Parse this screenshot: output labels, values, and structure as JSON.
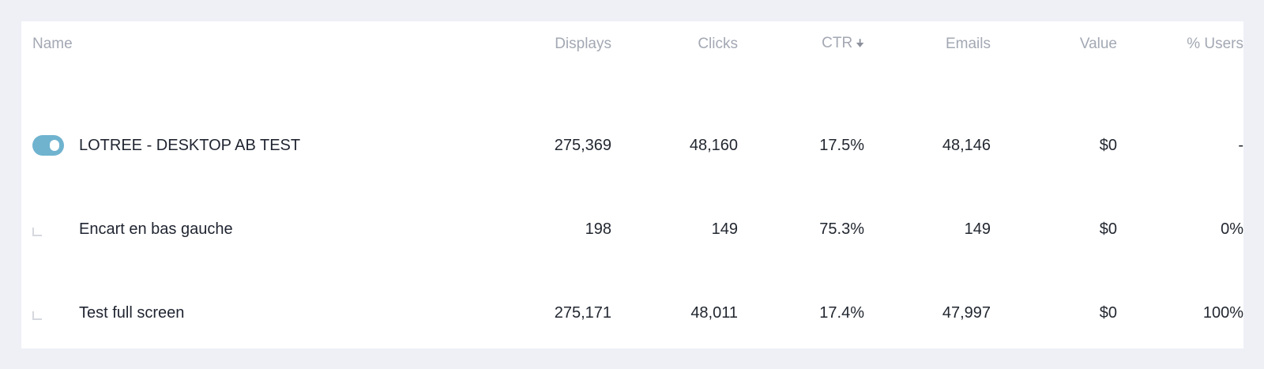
{
  "table": {
    "columns": {
      "name": "Name",
      "displays": "Displays",
      "clicks": "Clicks",
      "ctr": "CTR",
      "emails": "Emails",
      "value": "Value",
      "users": "% Users"
    },
    "sort_icon": "arrow-down-icon",
    "rows": [
      {
        "name": "LOTREE - DESKTOP AB TEST",
        "enabled": true,
        "displays": "275,369",
        "clicks": "48,160",
        "ctr": "17.5%",
        "emails": "48,146",
        "value": "$0",
        "users": "-"
      },
      {
        "name": "Encart en bas gauche",
        "displays": "198",
        "clicks": "149",
        "ctr": "75.3%",
        "emails": "149",
        "value": "$0",
        "users": "0%"
      },
      {
        "name": "Test full screen",
        "displays": "275,171",
        "clicks": "48,011",
        "ctr": "17.4%",
        "emails": "47,997",
        "value": "$0",
        "users": "100%"
      }
    ]
  },
  "colors": {
    "toggle_on": "#6fb3cf",
    "background": "#eef0f6",
    "header_text": "#a3a8b3"
  }
}
